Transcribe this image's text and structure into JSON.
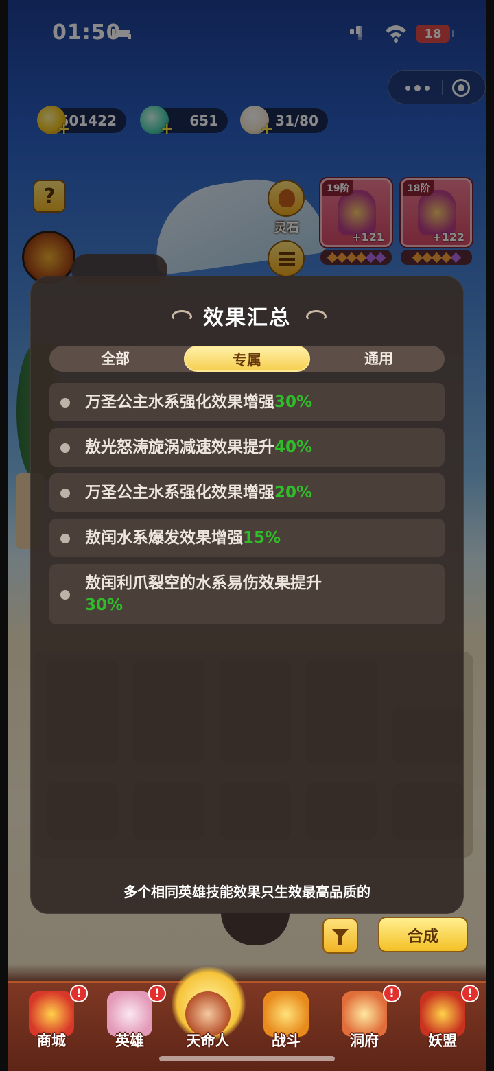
{
  "status_bar": {
    "time": "01:50",
    "battery": "18"
  },
  "currency": [
    {
      "icon": "gold-coin-icon",
      "value": "501422"
    },
    {
      "icon": "jade-icon",
      "value": "651"
    },
    {
      "icon": "bun-icon",
      "value": "31/80"
    }
  ],
  "side": {
    "help": "?",
    "stone_label": "灵石"
  },
  "cards": [
    {
      "tier": "19阶",
      "level": "+121"
    },
    {
      "tier": "18阶",
      "level": "+122"
    }
  ],
  "modal": {
    "title": "效果汇总",
    "tabs": [
      {
        "label": "全部",
        "active": false
      },
      {
        "label": "专属",
        "active": true
      },
      {
        "label": "通用",
        "active": false
      }
    ],
    "effects": [
      {
        "text": "万圣公主水系强化效果增强",
        "value": "30%"
      },
      {
        "text": "敖光怒涛旋涡减速效果提升",
        "value": "40%"
      },
      {
        "text": "万圣公主水系强化效果增强",
        "value": "20%"
      },
      {
        "text": "敖闰水系爆发效果增强",
        "value": "15%"
      },
      {
        "text": "敖闰利爪裂空的水系易伤效果提升",
        "value": "30%"
      }
    ],
    "note": "多个相同英雄技能效果只生效最高品质的"
  },
  "actions": {
    "synthesize": "合成"
  },
  "nav": [
    {
      "label": "商城",
      "badge": "!"
    },
    {
      "label": "英雄",
      "badge": "!"
    },
    {
      "label": "天命人",
      "badge": ""
    },
    {
      "label": "战斗",
      "badge": ""
    },
    {
      "label": "洞府",
      "badge": "!"
    },
    {
      "label": "妖盟",
      "badge": "!"
    }
  ],
  "colors": {
    "accent_green": "#2fbe2a",
    "tab_active": "#f6cf51",
    "modal_bg": "#342a26"
  }
}
